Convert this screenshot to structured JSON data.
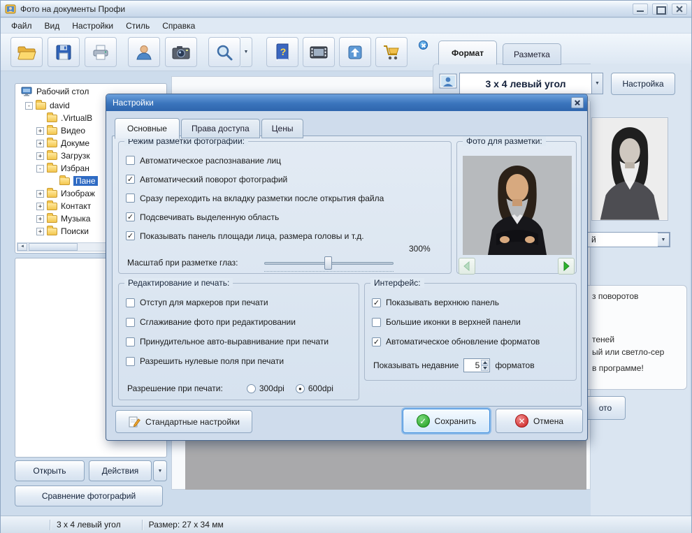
{
  "window": {
    "title": "Фото на документы Профи"
  },
  "menu": {
    "items": [
      {
        "label": "Файл"
      },
      {
        "label": "Вид"
      },
      {
        "label": "Настройки"
      },
      {
        "label": "Стиль"
      },
      {
        "label": "Справка"
      }
    ]
  },
  "icons": {
    "dropdown": "▼",
    "scroll_left": "◄",
    "scroll_right": "►",
    "help_q": "?",
    "save_check": "✓",
    "cancel_cross": "✕"
  },
  "left_panel": {
    "root_label": "Рабочий стол",
    "tree": [
      {
        "label": "david",
        "exp": "-"
      },
      {
        "label": ".VirtualB",
        "exp": ""
      },
      {
        "label": "Видео",
        "exp": "+"
      },
      {
        "label": "Докуме",
        "exp": "+"
      },
      {
        "label": "Загрузк",
        "exp": "+"
      },
      {
        "label": "Избран",
        "exp": "-"
      },
      {
        "label": "Пане",
        "exp": ""
      },
      {
        "label": "Изображ",
        "exp": "+"
      },
      {
        "label": "Контакт",
        "exp": "+"
      },
      {
        "label": "Музыка",
        "exp": "+"
      },
      {
        "label": "Поиски",
        "exp": "+"
      }
    ],
    "open_button": "Открыть",
    "actions_button": "Действия",
    "compare_button": "Сравнение фотографий"
  },
  "right_panel": {
    "tabs": [
      {
        "label": "Формат"
      },
      {
        "label": "Разметка"
      }
    ],
    "format_value": "3 х 4 левый угол",
    "settings_button": "Настройка",
    "partial_combo": "й",
    "partial_lines": [
      "з поворотов",
      "теней",
      "ый или светло-сер",
      "в программе!"
    ],
    "partial_button": "ото"
  },
  "status_bar": {
    "format": "3 х 4 левый угол",
    "size": "Размер: 27 х 34 мм"
  },
  "dialog": {
    "title": "Настройки",
    "tabs": [
      {
        "label": "Основные"
      },
      {
        "label": "Права доступа"
      },
      {
        "label": "Цены"
      }
    ],
    "marking": {
      "legend": "Режим разметки фотографии:",
      "items": [
        {
          "label": "Автоматическое распознавание лиц",
          "mark": ""
        },
        {
          "label": "Автоматический поворот фотографий",
          "mark": "✓"
        },
        {
          "label": "Сразу переходить на вкладку разметки после открытия файла",
          "mark": ""
        },
        {
          "label": "Подсвечивать выделенную область",
          "mark": "✓"
        },
        {
          "label": "Показывать панель площади лица, размера головы и т.д.",
          "mark": "✓"
        }
      ],
      "slider_label": "Масштаб при разметке глаз:",
      "zoom_value": "300%"
    },
    "photo": {
      "legend": "Фото для разметки:"
    },
    "editing": {
      "legend": "Редактирование и печать:",
      "items": [
        {
          "label": "Отступ для маркеров при печати",
          "mark": ""
        },
        {
          "label": "Сглаживание фото при редактировании",
          "mark": ""
        },
        {
          "label": "Принудительное авто-выравнивание при печати",
          "mark": ""
        },
        {
          "label": "Разрешить нулевые поля при печати",
          "mark": ""
        }
      ],
      "resolution_label": "Разрешение при печати:",
      "radios": [
        {
          "label": "300dpi",
          "mark": ""
        },
        {
          "label": "600dpi",
          "mark": "●"
        }
      ]
    },
    "interface": {
      "legend": "Интерфейс:",
      "items": [
        {
          "label": "Показывать верхнюю панель",
          "mark": "✓"
        },
        {
          "label": "Большие иконки в верхней панели",
          "mark": ""
        },
        {
          "label": "Автоматическое обновление форматов",
          "mark": "✓"
        }
      ],
      "recent_label": "Показывать недавние",
      "recent_value": "5",
      "recent_suffix": "форматов"
    },
    "buttons": {
      "defaults": "Стандартные настройки",
      "save": "Сохранить",
      "cancel": "Отмена"
    }
  }
}
